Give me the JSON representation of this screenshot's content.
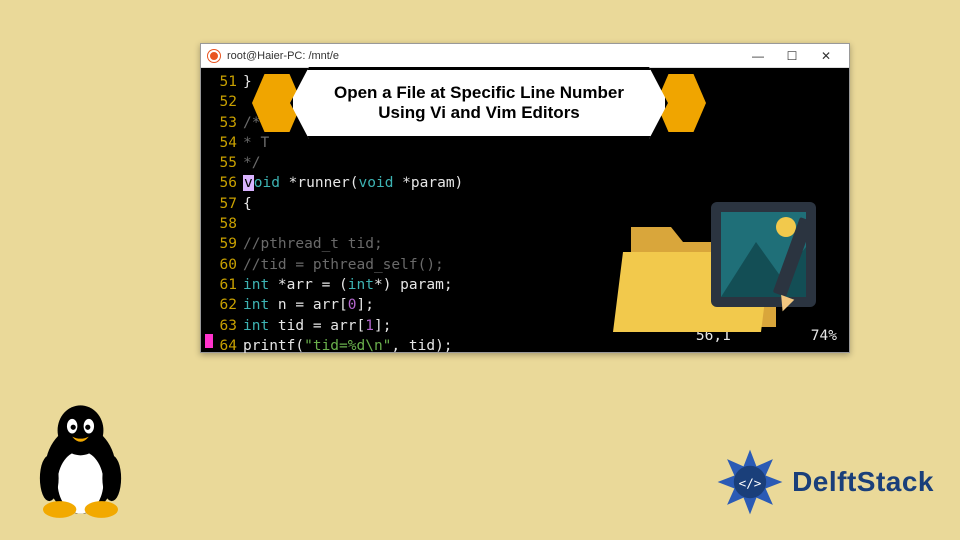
{
  "window": {
    "title": "root@Haier-PC: /mnt/e",
    "controls": {
      "min": "—",
      "max": "☐",
      "close": "✕"
    }
  },
  "headline": {
    "line1": "Open a File at Specific Line Number",
    "line2": "Using Vi and Vim Editors"
  },
  "code": {
    "lines": [
      {
        "num": "51",
        "segments": [
          {
            "cls": "white",
            "text": "}"
          }
        ]
      },
      {
        "num": "52",
        "segments": []
      },
      {
        "num": "53",
        "segments": [
          {
            "cls": "gray",
            "text": "/**"
          }
        ]
      },
      {
        "num": "54",
        "segments": [
          {
            "cls": "gray",
            "text": " * T"
          }
        ]
      },
      {
        "num": "55",
        "segments": [
          {
            "cls": "gray",
            "text": " */"
          }
        ]
      },
      {
        "num": "56",
        "segments": [
          {
            "cls": "cursor-highlight",
            "text": "v"
          },
          {
            "cls": "teal",
            "text": "oid"
          },
          {
            "cls": "white",
            "text": " *runner("
          },
          {
            "cls": "teal",
            "text": "void"
          },
          {
            "cls": "white",
            "text": " *param)"
          }
        ]
      },
      {
        "num": "57",
        "segments": [
          {
            "cls": "white",
            "text": "{"
          }
        ]
      },
      {
        "num": "58",
        "segments": []
      },
      {
        "num": "59",
        "segments": [
          {
            "cls": "gray",
            "text": "//pthread_t   tid;"
          }
        ]
      },
      {
        "num": "60",
        "segments": [
          {
            "cls": "gray",
            "text": "//tid = pthread_self();"
          }
        ]
      },
      {
        "num": "61",
        "segments": [
          {
            "cls": "teal",
            "text": "int"
          },
          {
            "cls": "white",
            "text": " *arr = ("
          },
          {
            "cls": "teal",
            "text": "int"
          },
          {
            "cls": "white",
            "text": "*) param;"
          }
        ]
      },
      {
        "num": "62",
        "segments": [
          {
            "cls": "teal",
            "text": "int"
          },
          {
            "cls": "white",
            "text": " n = arr["
          },
          {
            "cls": "purple",
            "text": "0"
          },
          {
            "cls": "white",
            "text": "];"
          }
        ]
      },
      {
        "num": "63",
        "segments": [
          {
            "cls": "teal",
            "text": "int"
          },
          {
            "cls": "white",
            "text": " tid = arr["
          },
          {
            "cls": "purple",
            "text": "1"
          },
          {
            "cls": "white",
            "text": "];"
          }
        ]
      },
      {
        "num": "64",
        "segments": [
          {
            "cls": "white",
            "text": "printf("
          },
          {
            "cls": "green",
            "text": "\"tid=%d\\n\""
          },
          {
            "cls": "white",
            "text": ", tid);"
          }
        ]
      }
    ]
  },
  "status": {
    "position": "56,1",
    "percent": "74%"
  },
  "brand": {
    "name": "DelftStack"
  },
  "icons": {
    "tux": "tux-penguin-icon",
    "ubuntu": "ubuntu-icon",
    "folder": "folder-icon",
    "image_frame": "image-frame-icon",
    "pencil": "pencil-icon",
    "delft_badge": "delft-badge-icon"
  }
}
